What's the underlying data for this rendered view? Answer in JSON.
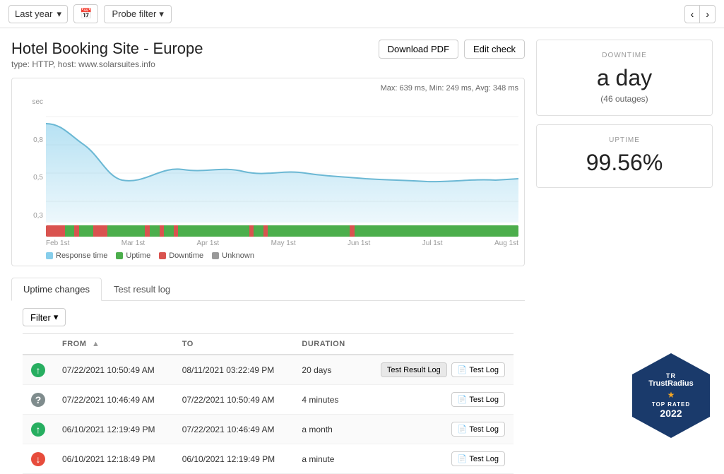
{
  "topbar": {
    "date_filter": "Last year",
    "probe_filter_label": "Probe filter",
    "calendar_icon": "📅",
    "nav_prev": "‹",
    "nav_next": "›"
  },
  "header": {
    "title": "Hotel Booking Site - Europe",
    "subtitle": "type: HTTP, host: www.solarsuites.info",
    "download_pdf_label": "Download PDF",
    "edit_check_label": "Edit check"
  },
  "chart": {
    "stats": "Max: 639 ms, Min: 249 ms, Avg: 348 ms",
    "y_labels": [
      "0,8",
      "0,5",
      "0,3"
    ],
    "sec_label": "sec",
    "x_labels": [
      "Feb 1st",
      "Mar 1st",
      "Apr 1st",
      "May 1st",
      "Jun 1st",
      "Jul 1st",
      "Aug 1st"
    ]
  },
  "legend": {
    "response_time_label": "Response time",
    "uptime_label": "Uptime",
    "downtime_label": "Downtime",
    "unknown_label": "Unknown",
    "response_color": "#87ceeb",
    "uptime_color": "#4cae4c",
    "downtime_color": "#d9534f",
    "unknown_color": "#999"
  },
  "right_panel": {
    "downtime_label": "DOWNTIME",
    "downtime_value": "a day",
    "downtime_sub": "(46 outages)",
    "uptime_label": "UPTIME",
    "uptime_value": "99.56%"
  },
  "tabs": [
    {
      "id": "uptime-changes",
      "label": "Uptime changes",
      "active": true
    },
    {
      "id": "test-result-log",
      "label": "Test result log",
      "active": false
    }
  ],
  "filter": {
    "label": "Filter",
    "chevron": "▾"
  },
  "table": {
    "columns": [
      {
        "id": "icon",
        "label": ""
      },
      {
        "id": "from",
        "label": "FROM",
        "sortable": true
      },
      {
        "id": "to",
        "label": "TO"
      },
      {
        "id": "duration",
        "label": "DURATION"
      },
      {
        "id": "actions",
        "label": ""
      }
    ],
    "rows": [
      {
        "status": "up",
        "from": "07/22/2021 10:50:49 AM",
        "to": "08/11/2021 03:22:49 PM",
        "duration": "20 days",
        "actions": [
          "Test Result Log",
          "Test Log"
        ],
        "active_action": "Test Result Log"
      },
      {
        "status": "unknown",
        "from": "07/22/2021 10:46:49 AM",
        "to": "07/22/2021 10:50:49 AM",
        "duration": "4 minutes",
        "actions": [
          "Test Log"
        ],
        "active_action": null
      },
      {
        "status": "up",
        "from": "06/10/2021 12:19:49 PM",
        "to": "07/22/2021 10:46:49 AM",
        "duration": "a month",
        "actions": [
          "Test Log"
        ],
        "active_action": null
      },
      {
        "status": "down",
        "from": "06/10/2021 12:18:49 PM",
        "to": "06/10/2021 12:19:49 PM",
        "duration": "a minute",
        "actions": [
          "Test Log"
        ],
        "active_action": null
      }
    ]
  },
  "badge": {
    "tr_label": "TR",
    "logo": "TrustRadius",
    "top_label": "TOP RATED",
    "year": "2022"
  }
}
